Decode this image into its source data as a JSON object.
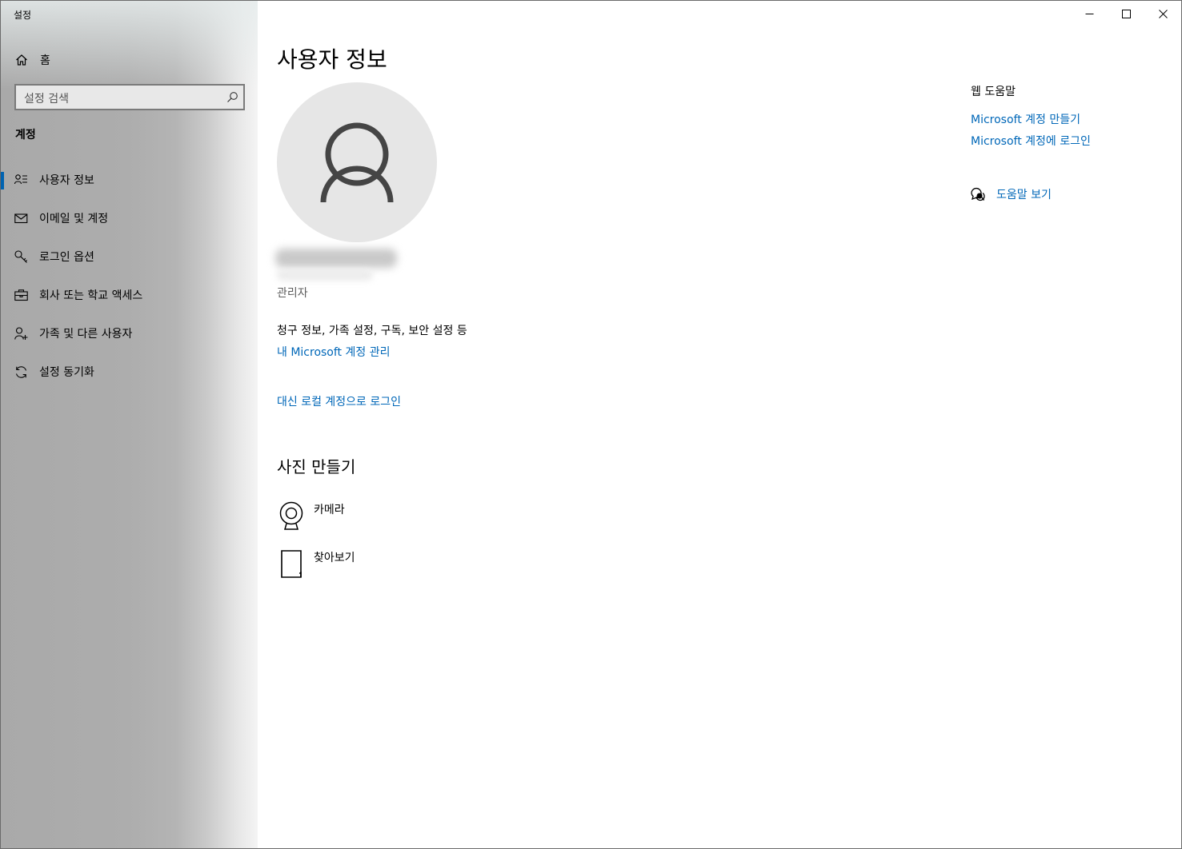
{
  "window": {
    "title": "설정",
    "controls": {
      "minimize_icon": "minimize-icon",
      "maximize_icon": "maximize-icon",
      "close_icon": "close-icon"
    }
  },
  "sidebar": {
    "home_label": "홈",
    "search_placeholder": "설정 검색",
    "section_title": "계정",
    "items": [
      {
        "label": "사용자 정보",
        "icon": "user-info-icon",
        "selected": true
      },
      {
        "label": "이메일 및 계정",
        "icon": "mail-icon",
        "selected": false
      },
      {
        "label": "로그인 옵션",
        "icon": "key-icon",
        "selected": false
      },
      {
        "label": "회사 또는 학교 액세스",
        "icon": "briefcase-icon",
        "selected": false
      },
      {
        "label": "가족 및 다른 사용자",
        "icon": "person-add-icon",
        "selected": false
      },
      {
        "label": "설정 동기화",
        "icon": "sync-icon",
        "selected": false
      }
    ],
    "accent_color": "#0063b1"
  },
  "main": {
    "title": "사용자 정보",
    "role": "관리자",
    "description": "청구 정보, 가족 설정, 구독, 보안 설정 등",
    "manage_link": "내 Microsoft 계정 관리",
    "local_login_link": "대신 로컬 계정으로 로그인",
    "photo_section_title": "사진 만들기",
    "photo_options": [
      {
        "label": "카메라",
        "icon": "camera-icon"
      },
      {
        "label": "찾아보기",
        "icon": "browse-icon"
      }
    ],
    "link_color": "#0067b8"
  },
  "help": {
    "title": "웹 도움말",
    "links": [
      "Microsoft 계정 만들기",
      "Microsoft 계정에 로그인"
    ],
    "get_help_label": "도움말 보기"
  }
}
